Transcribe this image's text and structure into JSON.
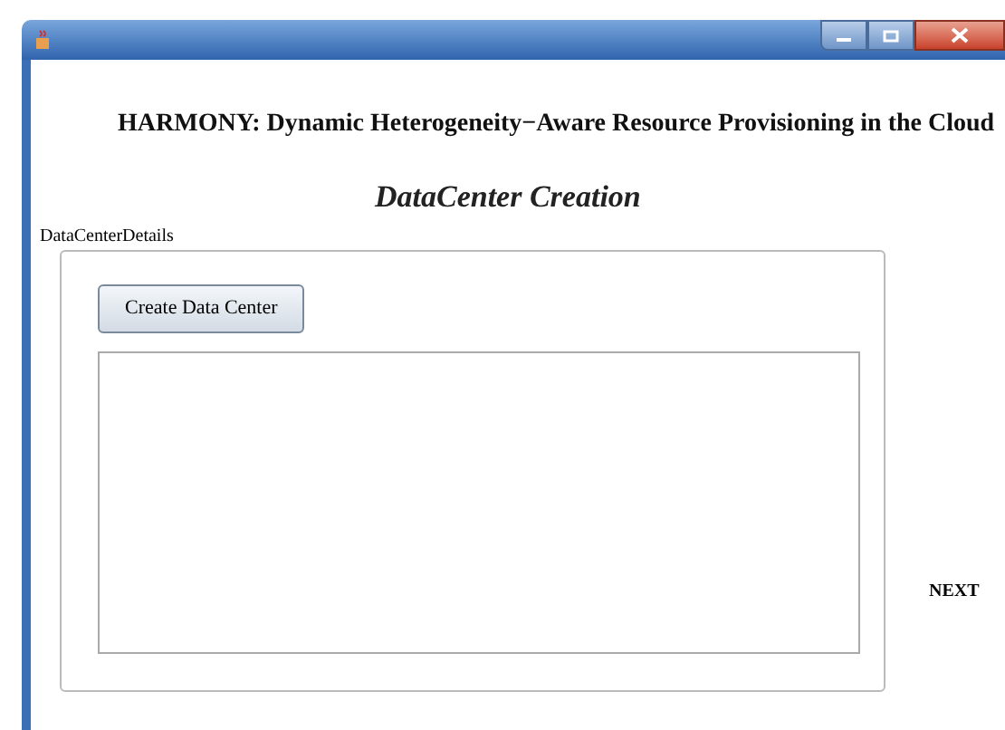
{
  "window": {
    "title_controls": [
      {
        "kind": "minimize"
      },
      {
        "kind": "maximize"
      },
      {
        "kind": "close"
      }
    ]
  },
  "header": "HARMONY: Dynamic Heterogeneity−Aware Resource Provisioning in the Cloud",
  "title": "DataCenter Creation",
  "panel": {
    "label": "DataCenterDetails",
    "button": "Create Data Center"
  },
  "next": "NEXT"
}
